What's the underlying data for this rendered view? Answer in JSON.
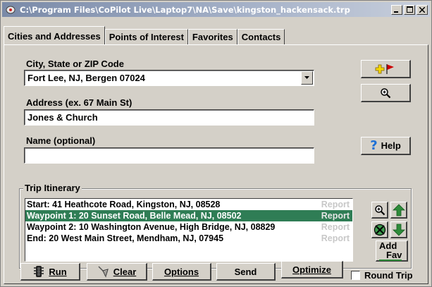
{
  "window": {
    "title": "C:\\Program Files\\CoPilot Live\\Laptop7\\NA\\Save\\kingston_hackensack.trp"
  },
  "tabs": [
    {
      "label": "Cities and Addresses",
      "active": true
    },
    {
      "label": "Points of Interest",
      "active": false
    },
    {
      "label": "Favorites",
      "active": false
    },
    {
      "label": "Contacts",
      "active": false
    }
  ],
  "form": {
    "city_label": "City, State or ZIP Code",
    "city_value": "Fort Lee, NJ, Bergen 07024",
    "address_label": "Address (ex. 67 Main St)",
    "address_value": "Jones & Church",
    "name_label": "Name (optional)",
    "name_value": ""
  },
  "side_buttons": {
    "add_icon": "add-stop-flag-icon",
    "zoom_icon": "magnify-icon",
    "help_label": "Help"
  },
  "itinerary": {
    "title": "Trip Itinerary",
    "rows": [
      {
        "text": "Start: 41 Heathcote Road, Kingston, NJ, 08528",
        "report": "Report",
        "selected": false
      },
      {
        "text": "Waypoint 1: 20 Sunset Road, Belle Mead, NJ, 08502",
        "report": "Report",
        "selected": true
      },
      {
        "text": "Waypoint 2: 10 Washington Avenue, High Bridge, NJ, 08829",
        "report": "Report",
        "selected": false
      },
      {
        "text": "End: 20 West Main Street, Mendham, NJ, 07945",
        "report": "Report",
        "selected": false
      }
    ],
    "add_fav_label_1": "Add",
    "add_fav_label_2": "Fav"
  },
  "bottom": {
    "run_label": "Run",
    "clear_label": "Clear",
    "options_label": "Options",
    "send_label": "Send",
    "optimize_label": "Optimize",
    "round_trip_label": "Round Trip",
    "round_trip_checked": false
  },
  "colors": {
    "selection": "#2f7d55",
    "arrow_green": "#2e8b3a",
    "flag_red": "#cc0000"
  }
}
